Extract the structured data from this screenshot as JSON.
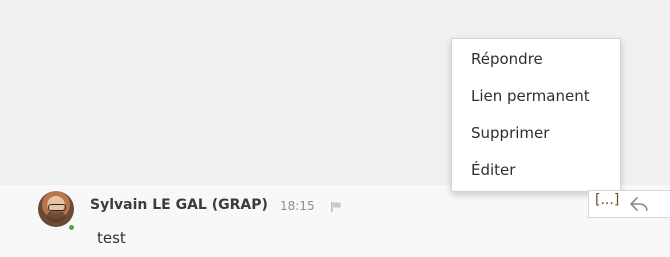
{
  "message": {
    "author": "Sylvain LE GAL (GRAP)",
    "time": "18:15",
    "body": "test",
    "status_color": "#4aa84a"
  },
  "menu": {
    "items": [
      "Répondre",
      "Lien permanent",
      "Supprimer",
      "Éditer"
    ]
  },
  "actions": {
    "expand_label": "[...]",
    "reply_icon": "reply-icon",
    "flag_icon": "flag-icon"
  },
  "colors": {
    "background": "#f1f1f1",
    "menu_bg": "#ffffff",
    "accent_brown": "#6b4b2a"
  }
}
